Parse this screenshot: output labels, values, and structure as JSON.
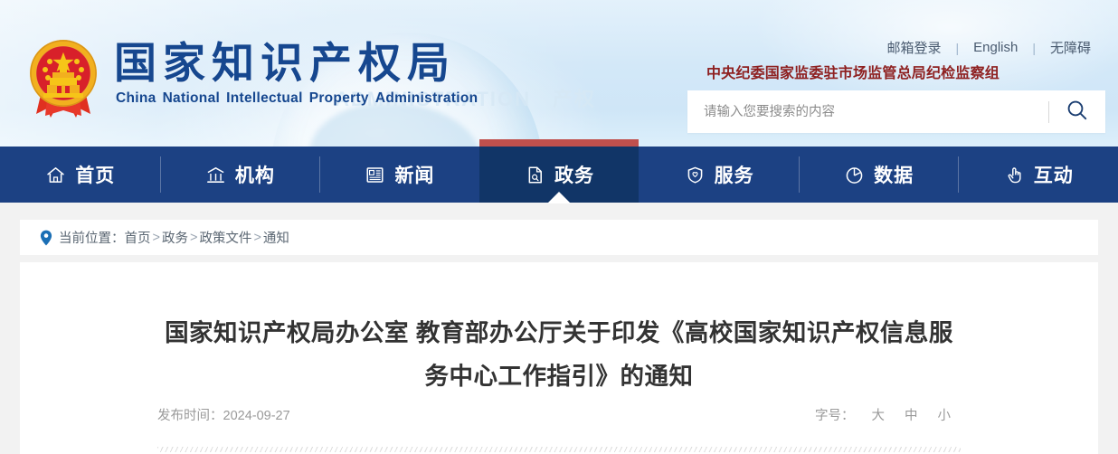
{
  "site": {
    "title": "国家知识产权局",
    "subtitle_words": [
      "China",
      "National",
      "Intellectual",
      "Property",
      "Administration"
    ],
    "subtitle": "China National Intellectual Property Administration",
    "watermark": "ADMINISTRATION　产权",
    "emblem_alt": "national-emblem"
  },
  "topbar": {
    "links": [
      {
        "label": "邮箱登录",
        "name": "mail-login-link"
      },
      {
        "label": "English",
        "name": "english-link"
      },
      {
        "label": "无障碍",
        "name": "accessibility-link"
      }
    ],
    "divider": "|",
    "branch_line": "中央纪委国家监委驻市场监管总局纪检监察组",
    "branch_color": "#8e2020"
  },
  "search": {
    "placeholder": "请输入您要搜索的内容",
    "value": "",
    "button_icon": "search-icon"
  },
  "nav": {
    "active_index": 3,
    "accent_color": "#c0504d",
    "background": "#1c4183",
    "items": [
      {
        "label": "首页",
        "icon": "home-icon"
      },
      {
        "label": "机构",
        "icon": "bank-icon"
      },
      {
        "label": "新闻",
        "icon": "newspaper-icon"
      },
      {
        "label": "政务",
        "icon": "document-icon"
      },
      {
        "label": "服务",
        "icon": "shield-heart-icon"
      },
      {
        "label": "数据",
        "icon": "pie-chart-icon"
      },
      {
        "label": "互动",
        "icon": "hand-pointer-icon"
      }
    ]
  },
  "breadcrumb": {
    "icon": "location-pin-icon",
    "label": "当前位置：",
    "separator": ">",
    "items": [
      {
        "label": "首页"
      },
      {
        "label": "政务"
      },
      {
        "label": "政策文件"
      },
      {
        "label": "通知"
      }
    ]
  },
  "article": {
    "title": "国家知识产权局办公室 教育部办公厅关于印发《高校国家知识产权信息服务中心工作指引》的通知",
    "publish_label": "发布时间：",
    "publish_date": "2024-09-27",
    "publish_full": "发布时间：2024-09-27",
    "fontsize": {
      "label": "字号：",
      "options": [
        {
          "label": "大"
        },
        {
          "label": "中"
        },
        {
          "label": "小"
        }
      ]
    }
  }
}
